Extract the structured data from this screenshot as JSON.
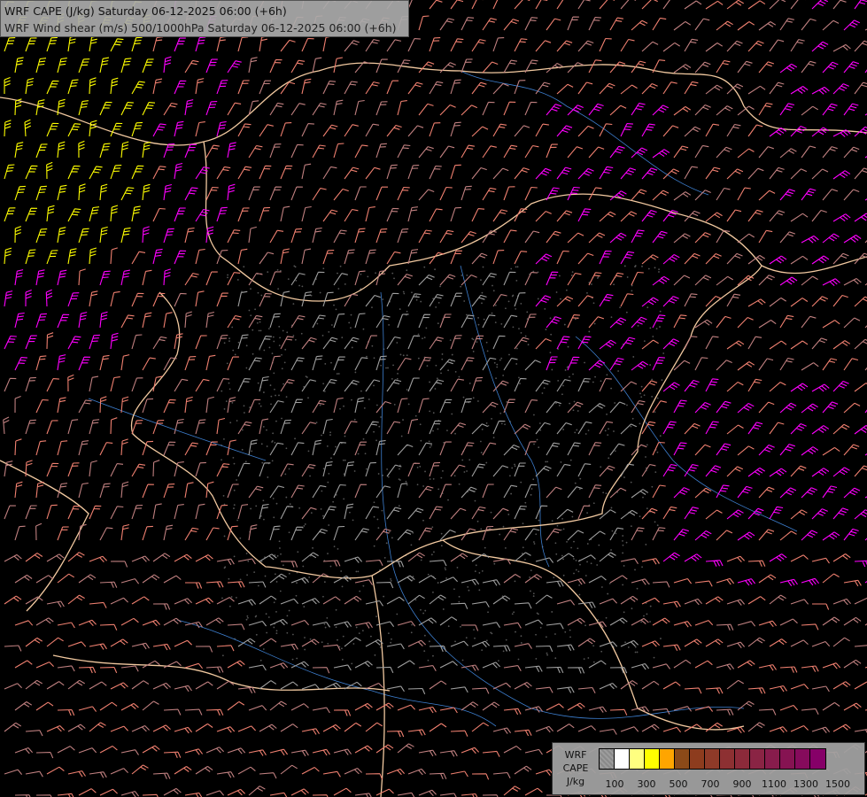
{
  "title": {
    "line1": "WRF CAPE (J/kg) Saturday 06-12-2025 06:00 (+6h)",
    "line2": "WRF Wind shear (m/s) 500/1000hPa Saturday 06-12-2025 06:00 (+6h)"
  },
  "legend": {
    "label_lines": [
      "WRF",
      "CAPE",
      "J/kg"
    ],
    "colors": [
      "#9a9a9a",
      "#ffffff",
      "#ffff80",
      "#ffff00",
      "#ffa500",
      "#8b4a18",
      "#8d3c1e",
      "#8e3a28",
      "#8d3032",
      "#8c2a3a",
      "#8a2444",
      "#881c4c",
      "#861352",
      "#860b5c",
      "#860068"
    ],
    "tick_labels": [
      "100",
      "300",
      "500",
      "700",
      "900",
      "1100",
      "1300",
      "1500"
    ]
  },
  "map_colors": {
    "background": "#000000",
    "border": "#f2c9a0",
    "river": "#3d7fd0",
    "barb_strong": "#ff00ff",
    "barb_very_strong": "#ffff00",
    "barb_medium": "#f08070",
    "barb_light": "#c08080",
    "barb_weak": "#a0a0a0"
  }
}
